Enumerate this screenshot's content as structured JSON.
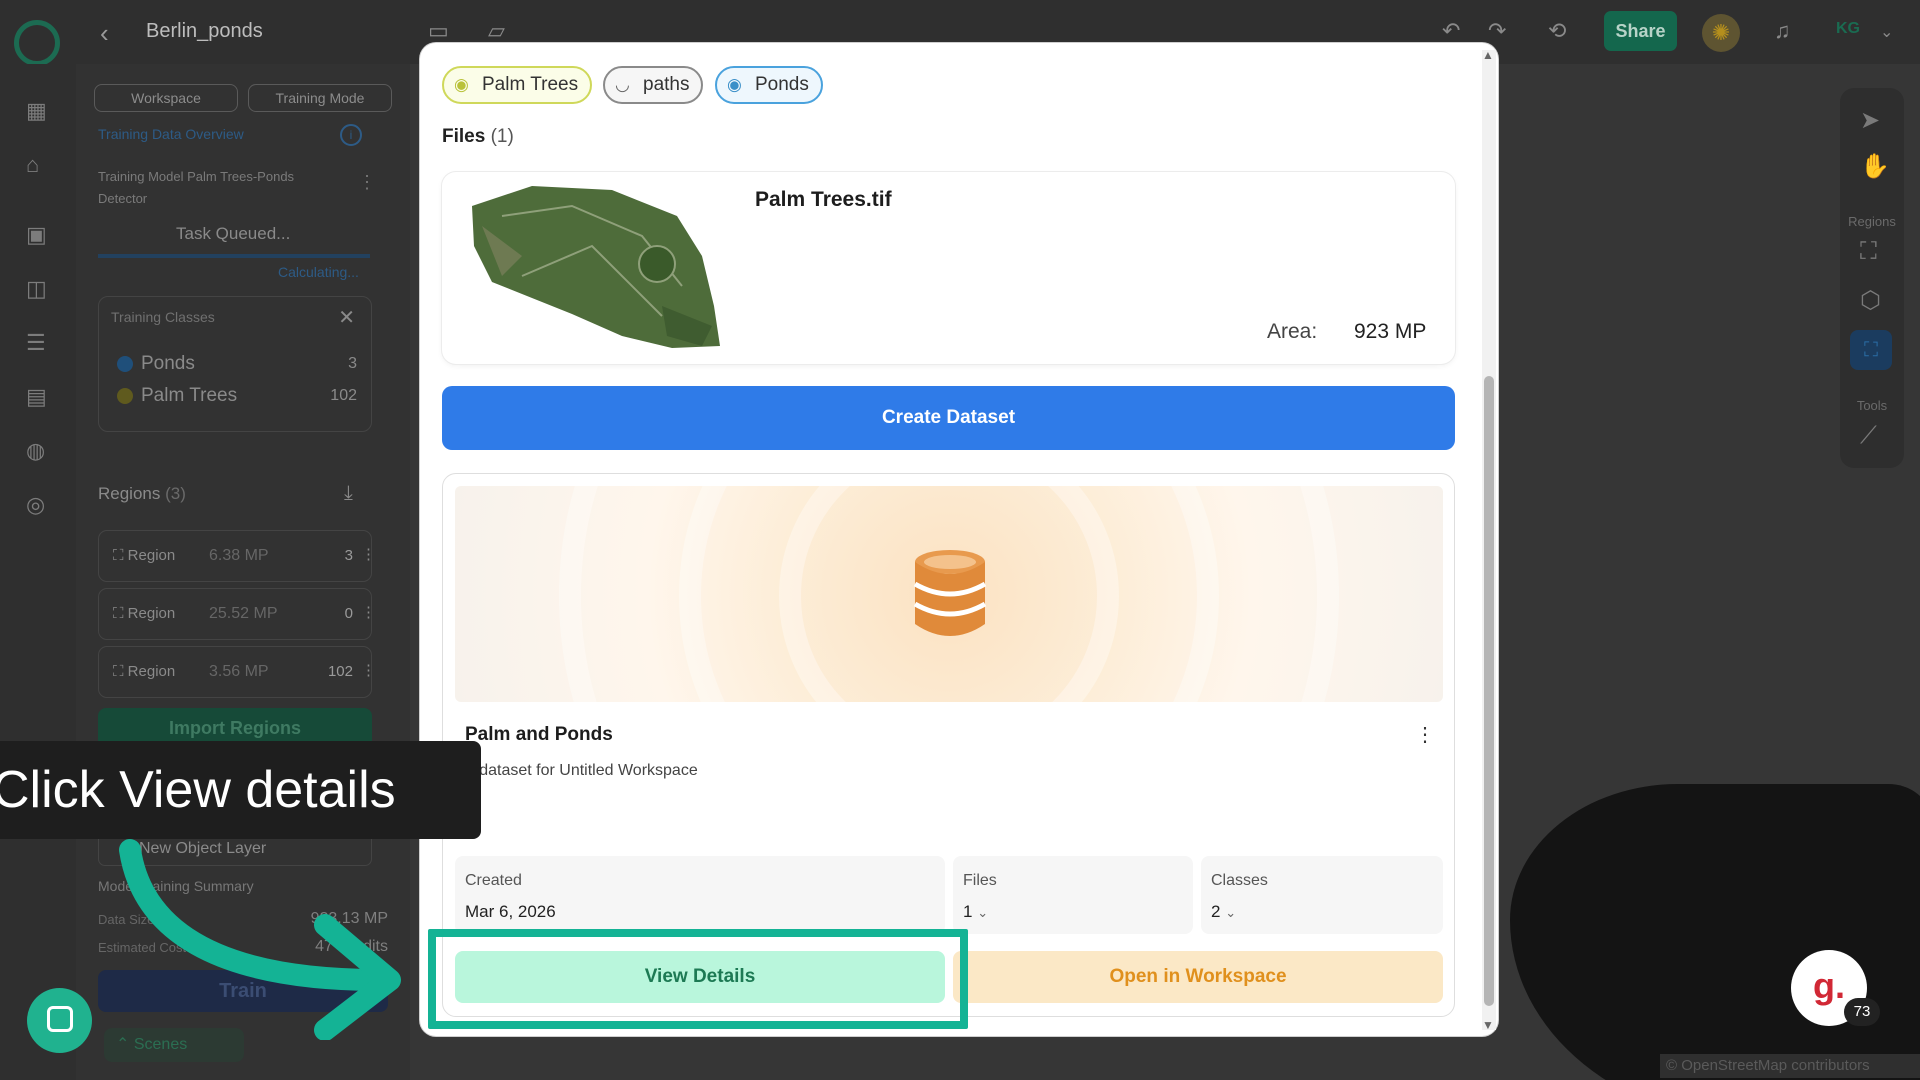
{
  "header": {
    "project_title": "Berlin_ponds",
    "share_label": "Share",
    "user_initials": "KG"
  },
  "left_panel": {
    "tabs": [
      "Workspace",
      "Training Mode"
    ],
    "overview_link": "Training Data Overview",
    "model_name": "Training Model Palm Trees-Ponds Detector",
    "status": "Task Queued...",
    "calculating": "Calculating...",
    "classes_title": "Training Classes",
    "classes": [
      {
        "name": "Ponds",
        "count": "3",
        "color": "#1f4f7a"
      },
      {
        "name": "Palm Trees",
        "count": "102",
        "color": "#5f5a1e"
      }
    ],
    "regions_title": "Regions",
    "regions_count": "(3)",
    "regions": [
      {
        "label": "Region",
        "size": "6.38 MP",
        "count": "3"
      },
      {
        "label": "Region",
        "size": "25.52 MP",
        "count": "0"
      },
      {
        "label": "Region",
        "size": "3.56 MP",
        "count": "102"
      }
    ],
    "import_label": "Import Regions",
    "object_layer": "New Object Layer",
    "summary_title": "Model Training Summary",
    "data_size_label": "Data Size",
    "data_size_value": "923.13 MP",
    "estimated_label": "Estimated Cost",
    "estimated_value": "47 Credits",
    "train_label": "Train",
    "scenes_label": "Scenes"
  },
  "map": {
    "regions_label": "Regions",
    "tools_label": "Tools",
    "attribution": "© OpenStreetMap contributors"
  },
  "modal": {
    "layers": [
      {
        "name": "Palm Trees",
        "color": "#cfd85a",
        "icon": "eye-icon"
      },
      {
        "name": "paths",
        "color": "#8a8a8a",
        "icon": "eye-off-icon"
      },
      {
        "name": "Ponds",
        "color": "#4aa2dd",
        "icon": "eye-icon"
      }
    ],
    "files_title": "Files",
    "files_count": "(1)",
    "file": {
      "name": "Palm Trees.tif",
      "area_label": "Area:",
      "area_value": "923 MP"
    },
    "create_dataset_label": "Create Dataset",
    "dataset": {
      "name": "Palm and Ponds",
      "description": "A dataset for Untitled Workspace",
      "created_label": "Created",
      "created_value": "Mar 6, 2026",
      "files_label": "Files",
      "files_value": "1",
      "classes_label": "Classes",
      "classes_value": "2",
      "view_label": "View Details",
      "open_label": "Open in Workspace"
    }
  },
  "overlay": {
    "callout_text": "Click View details",
    "accent": "#14b395"
  },
  "badges": {
    "g_letter": "g.",
    "g_count": "73"
  }
}
